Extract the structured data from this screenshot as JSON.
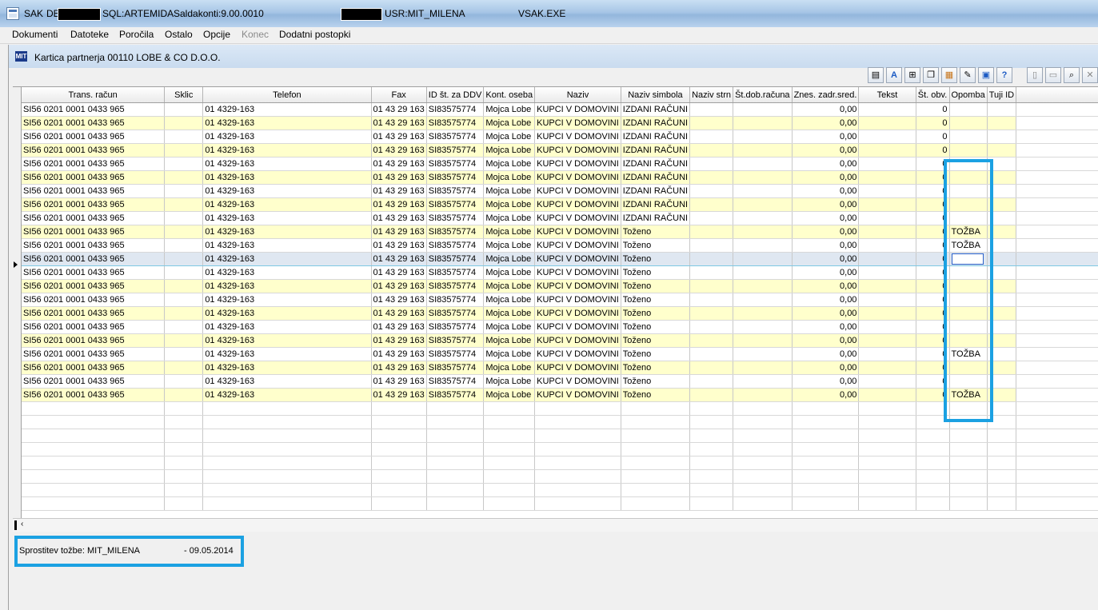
{
  "window": {
    "app": "SAK",
    "db_label": "DB",
    "sql": "SQL:ARTEMIDA",
    "saldakonti": "Saldakonti:9.00.0010",
    "user": "USR:MIT_MILENA",
    "exe": "VSAK.EXE"
  },
  "menu": [
    "Dokumenti",
    "Datoteke",
    "Poročila",
    "Ostalo",
    "Opcije",
    "Konec",
    "Dodatni postopki"
  ],
  "menu_disabled": [
    "Konec"
  ],
  "inner_window": {
    "logo": "MIT",
    "title": "Kartica partnerja 00110 LOBE & CO D.O.O."
  },
  "toolbar_icons": [
    "report-icon",
    "font-icon",
    "tree-icon",
    "copy-icon",
    "folder-stack-icon",
    "attach-icon",
    "screen-icon",
    "help-icon",
    "new-document-icon",
    "open-folder-icon",
    "search-icon",
    "close-icon",
    "more-icon"
  ],
  "columns": [
    "Trans. račun",
    "Sklic",
    "Telefon",
    "Fax",
    "ID št. za DDV",
    "Kont. oseba",
    "Naziv",
    "Naziv simbola",
    "Naziv strn",
    "Št.dob.računa",
    "Znes. zadr.sred.",
    "Tekst",
    "Št. obv.",
    "Opomba",
    "Tuji ID"
  ],
  "rows": [
    {
      "trans": "SI56 0201 0001 0433 965",
      "sklic": "",
      "tel": "01 4329-163",
      "fax": "01 43 29 163",
      "ddv": "SI83575774",
      "oseba": "Mojca Lobe",
      "naziv": "KUPCI V DOMOVINI",
      "simbol": "IZDANI RAČUNI",
      "strn": "",
      "dob": "",
      "znes": "0,00",
      "tekst": "",
      "obv": "0",
      "opomba": "",
      "tuji": ""
    },
    {
      "trans": "SI56 0201 0001 0433 965",
      "sklic": "",
      "tel": "01 4329-163",
      "fax": "01 43 29 163",
      "ddv": "SI83575774",
      "oseba": "Mojca Lobe",
      "naziv": "KUPCI V DOMOVINI",
      "simbol": "IZDANI RAČUNI",
      "strn": "",
      "dob": "",
      "znes": "0,00",
      "tekst": "",
      "obv": "0",
      "opomba": "",
      "tuji": ""
    },
    {
      "trans": "SI56 0201 0001 0433 965",
      "sklic": "",
      "tel": "01 4329-163",
      "fax": "01 43 29 163",
      "ddv": "SI83575774",
      "oseba": "Mojca Lobe",
      "naziv": "KUPCI V DOMOVINI",
      "simbol": "IZDANI RAČUNI",
      "strn": "",
      "dob": "",
      "znes": "0,00",
      "tekst": "",
      "obv": "0",
      "opomba": "",
      "tuji": ""
    },
    {
      "trans": "SI56 0201 0001 0433 965",
      "sklic": "",
      "tel": "01 4329-163",
      "fax": "01 43 29 163",
      "ddv": "SI83575774",
      "oseba": "Mojca Lobe",
      "naziv": "KUPCI V DOMOVINI",
      "simbol": "IZDANI RAČUNI",
      "strn": "",
      "dob": "",
      "znes": "0,00",
      "tekst": "",
      "obv": "0",
      "opomba": "",
      "tuji": ""
    },
    {
      "trans": "SI56 0201 0001 0433 965",
      "sklic": "",
      "tel": "01 4329-163",
      "fax": "01 43 29 163",
      "ddv": "SI83575774",
      "oseba": "Mojca Lobe",
      "naziv": "KUPCI V DOMOVINI",
      "simbol": "IZDANI RAČUNI",
      "strn": "",
      "dob": "",
      "znes": "0,00",
      "tekst": "",
      "obv": "0",
      "opomba": "",
      "tuji": ""
    },
    {
      "trans": "SI56 0201 0001 0433 965",
      "sklic": "",
      "tel": "01 4329-163",
      "fax": "01 43 29 163",
      "ddv": "SI83575774",
      "oseba": "Mojca Lobe",
      "naziv": "KUPCI V DOMOVINI",
      "simbol": "IZDANI RAČUNI",
      "strn": "",
      "dob": "",
      "znes": "0,00",
      "tekst": "",
      "obv": "0",
      "opomba": "",
      "tuji": ""
    },
    {
      "trans": "SI56 0201 0001 0433 965",
      "sklic": "",
      "tel": "01 4329-163",
      "fax": "01 43 29 163",
      "ddv": "SI83575774",
      "oseba": "Mojca Lobe",
      "naziv": "KUPCI V DOMOVINI",
      "simbol": "IZDANI RAČUNI",
      "strn": "",
      "dob": "",
      "znes": "0,00",
      "tekst": "",
      "obv": "0",
      "opomba": "",
      "tuji": ""
    },
    {
      "trans": "SI56 0201 0001 0433 965",
      "sklic": "",
      "tel": "01 4329-163",
      "fax": "01 43 29 163",
      "ddv": "SI83575774",
      "oseba": "Mojca Lobe",
      "naziv": "KUPCI V DOMOVINI",
      "simbol": "IZDANI RAČUNI",
      "strn": "",
      "dob": "",
      "znes": "0,00",
      "tekst": "",
      "obv": "0",
      "opomba": "",
      "tuji": ""
    },
    {
      "trans": "SI56 0201 0001 0433 965",
      "sklic": "",
      "tel": "01 4329-163",
      "fax": "01 43 29 163",
      "ddv": "SI83575774",
      "oseba": "Mojca Lobe",
      "naziv": "KUPCI V DOMOVINI",
      "simbol": "IZDANI RAČUNI",
      "strn": "",
      "dob": "",
      "znes": "0,00",
      "tekst": "",
      "obv": "0",
      "opomba": "",
      "tuji": ""
    },
    {
      "trans": "SI56 0201 0001 0433 965",
      "sklic": "",
      "tel": "01 4329-163",
      "fax": "01 43 29 163",
      "ddv": "SI83575774",
      "oseba": "Mojca Lobe",
      "naziv": "KUPCI V DOMOVINI",
      "simbol": "Toženo",
      "strn": "",
      "dob": "",
      "znes": "0,00",
      "tekst": "",
      "obv": "0",
      "opomba": "TOŽBA",
      "tuji": ""
    },
    {
      "trans": "SI56 0201 0001 0433 965",
      "sklic": "",
      "tel": "01 4329-163",
      "fax": "01 43 29 163",
      "ddv": "SI83575774",
      "oseba": "Mojca Lobe",
      "naziv": "KUPCI V DOMOVINI",
      "simbol": "Toženo",
      "strn": "",
      "dob": "",
      "znes": "0,00",
      "tekst": "",
      "obv": "0",
      "opomba": "TOŽBA",
      "tuji": ""
    },
    {
      "trans": "SI56 0201 0001 0433 965",
      "sklic": "",
      "tel": "01 4329-163",
      "fax": "01 43 29 163",
      "ddv": "SI83575774",
      "oseba": "Mojca Lobe",
      "naziv": "KUPCI V DOMOVINI",
      "simbol": "Toženo",
      "strn": "",
      "dob": "",
      "znes": "0,00",
      "tekst": "",
      "obv": "0",
      "opomba": "",
      "tuji": ""
    },
    {
      "trans": "SI56 0201 0001 0433 965",
      "sklic": "",
      "tel": "01 4329-163",
      "fax": "01 43 29 163",
      "ddv": "SI83575774",
      "oseba": "Mojca Lobe",
      "naziv": "KUPCI V DOMOVINI",
      "simbol": "Toženo",
      "strn": "",
      "dob": "",
      "znes": "0,00",
      "tekst": "",
      "obv": "0",
      "opomba": "",
      "tuji": ""
    },
    {
      "trans": "SI56 0201 0001 0433 965",
      "sklic": "",
      "tel": "01 4329-163",
      "fax": "01 43 29 163",
      "ddv": "SI83575774",
      "oseba": "Mojca Lobe",
      "naziv": "KUPCI V DOMOVINI",
      "simbol": "Toženo",
      "strn": "",
      "dob": "",
      "znes": "0,00",
      "tekst": "",
      "obv": "0",
      "opomba": "",
      "tuji": ""
    },
    {
      "trans": "SI56 0201 0001 0433 965",
      "sklic": "",
      "tel": "01 4329-163",
      "fax": "01 43 29 163",
      "ddv": "SI83575774",
      "oseba": "Mojca Lobe",
      "naziv": "KUPCI V DOMOVINI",
      "simbol": "Toženo",
      "strn": "",
      "dob": "",
      "znes": "0,00",
      "tekst": "",
      "obv": "0",
      "opomba": "",
      "tuji": ""
    },
    {
      "trans": "SI56 0201 0001 0433 965",
      "sklic": "",
      "tel": "01 4329-163",
      "fax": "01 43 29 163",
      "ddv": "SI83575774",
      "oseba": "Mojca Lobe",
      "naziv": "KUPCI V DOMOVINI",
      "simbol": "Toženo",
      "strn": "",
      "dob": "",
      "znes": "0,00",
      "tekst": "",
      "obv": "0",
      "opomba": "",
      "tuji": ""
    },
    {
      "trans": "SI56 0201 0001 0433 965",
      "sklic": "",
      "tel": "01 4329-163",
      "fax": "01 43 29 163",
      "ddv": "SI83575774",
      "oseba": "Mojca Lobe",
      "naziv": "KUPCI V DOMOVINI",
      "simbol": "Toženo",
      "strn": "",
      "dob": "",
      "znes": "0,00",
      "tekst": "",
      "obv": "0",
      "opomba": "",
      "tuji": ""
    },
    {
      "trans": "SI56 0201 0001 0433 965",
      "sklic": "",
      "tel": "01 4329-163",
      "fax": "01 43 29 163",
      "ddv": "SI83575774",
      "oseba": "Mojca Lobe",
      "naziv": "KUPCI V DOMOVINI",
      "simbol": "Toženo",
      "strn": "",
      "dob": "",
      "znes": "0,00",
      "tekst": "",
      "obv": "0",
      "opomba": "",
      "tuji": ""
    },
    {
      "trans": "SI56 0201 0001 0433 965",
      "sklic": "",
      "tel": "01 4329-163",
      "fax": "01 43 29 163",
      "ddv": "SI83575774",
      "oseba": "Mojca Lobe",
      "naziv": "KUPCI V DOMOVINI",
      "simbol": "Toženo",
      "strn": "",
      "dob": "",
      "znes": "0,00",
      "tekst": "",
      "obv": "0",
      "opomba": "TOŽBA",
      "tuji": ""
    },
    {
      "trans": "SI56 0201 0001 0433 965",
      "sklic": "",
      "tel": "01 4329-163",
      "fax": "01 43 29 163",
      "ddv": "SI83575774",
      "oseba": "Mojca Lobe",
      "naziv": "KUPCI V DOMOVINI",
      "simbol": "Toženo",
      "strn": "",
      "dob": "",
      "znes": "0,00",
      "tekst": "",
      "obv": "0",
      "opomba": "",
      "tuji": ""
    },
    {
      "trans": "SI56 0201 0001 0433 965",
      "sklic": "",
      "tel": "01 4329-163",
      "fax": "01 43 29 163",
      "ddv": "SI83575774",
      "oseba": "Mojca Lobe",
      "naziv": "KUPCI V DOMOVINI",
      "simbol": "Toženo",
      "strn": "",
      "dob": "",
      "znes": "0,00",
      "tekst": "",
      "obv": "0",
      "opomba": "",
      "tuji": ""
    },
    {
      "trans": "SI56 0201 0001 0433 965",
      "sklic": "",
      "tel": "01 4329-163",
      "fax": "01 43 29 163",
      "ddv": "SI83575774",
      "oseba": "Mojca Lobe",
      "naziv": "KUPCI V DOMOVINI",
      "simbol": "Toženo",
      "strn": "",
      "dob": "",
      "znes": "0,00",
      "tekst": "",
      "obv": "0",
      "opomba": "TOŽBA",
      "tuji": ""
    }
  ],
  "selected_row": 11,
  "status": {
    "text": "Sprostitev tožbe: MIT_MILENA",
    "date": "- 09.05.2014"
  },
  "colors": {
    "highlight": "#1ba1e2",
    "row_alt": "#ffffcc",
    "row_selected": "#dfe7f1"
  }
}
